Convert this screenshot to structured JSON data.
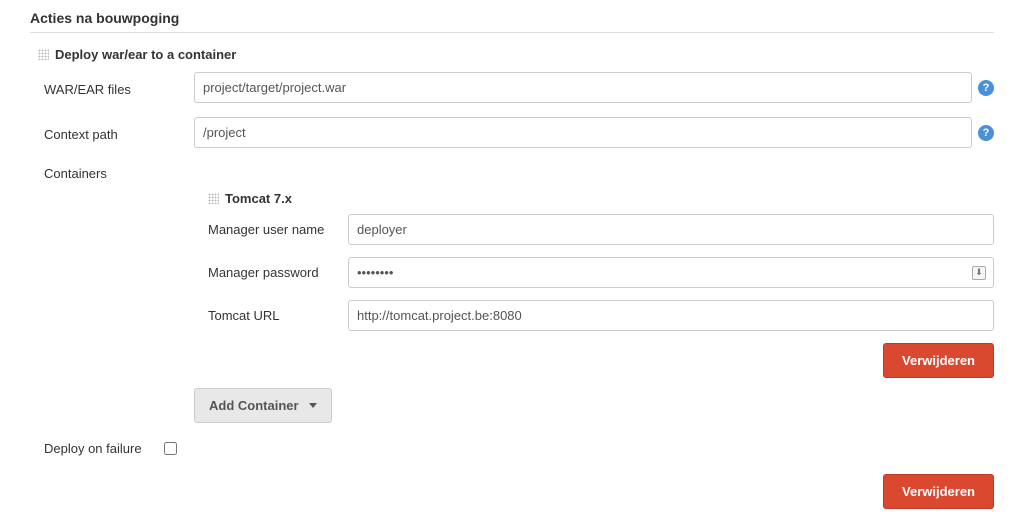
{
  "section_title": "Acties na bouwpoging",
  "deploy_block": {
    "title": "Deploy war/ear to a container",
    "war_ear_files": {
      "label": "WAR/EAR files",
      "value": "project/target/project.war"
    },
    "context_path": {
      "label": "Context path",
      "value": "/project"
    },
    "containers_label": "Containers",
    "container": {
      "title": "Tomcat 7.x",
      "manager_user": {
        "label": "Manager user name",
        "value": "deployer"
      },
      "manager_password": {
        "label": "Manager password",
        "value": "••••••••"
      },
      "tomcat_url": {
        "label": "Tomcat URL",
        "value": "http://tomcat.project.be:8080"
      },
      "delete_label": "Verwijderen"
    },
    "add_container_label": "Add Container",
    "deploy_on_failure_label": "Deploy on failure",
    "outer_delete_label": "Verwijderen"
  },
  "help_glyph": "?"
}
